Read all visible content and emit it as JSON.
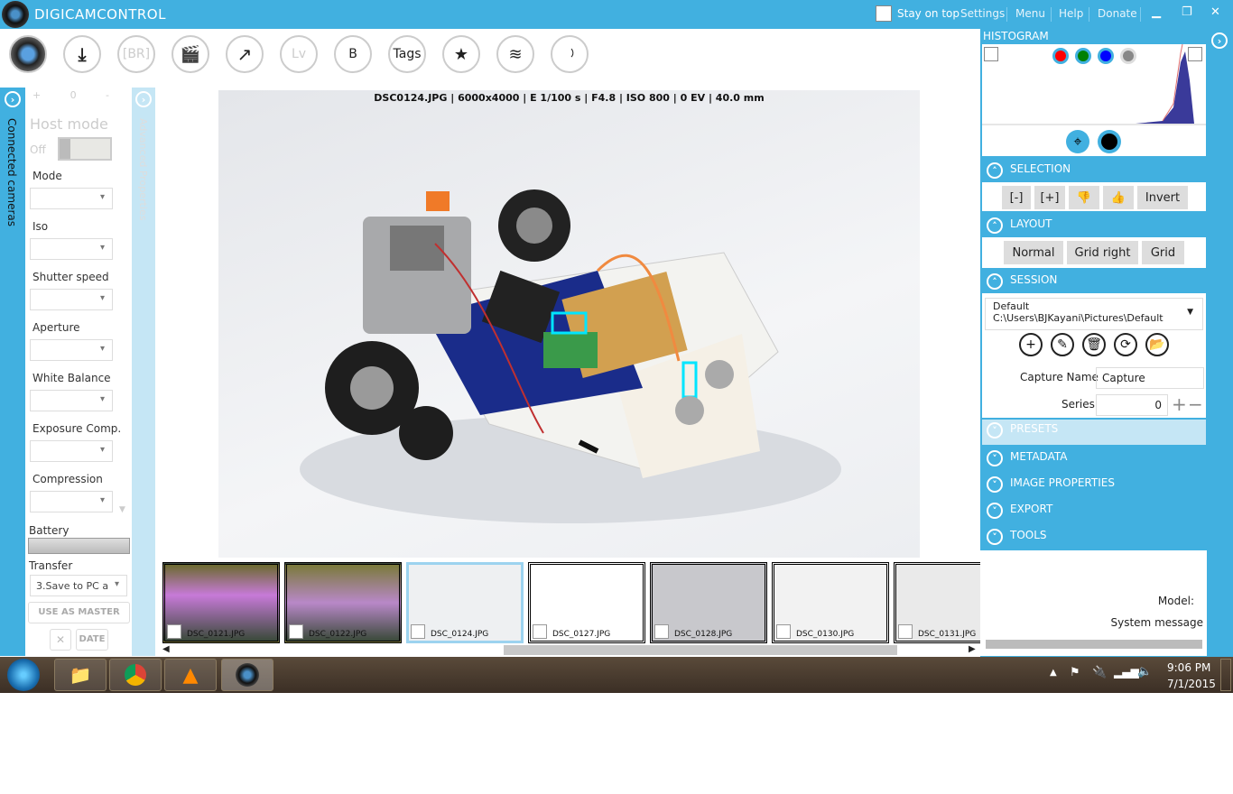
{
  "title": {
    "app": "DIGICAMCONTROL",
    "stay_on_top": "Stay on top",
    "menu": [
      "Settings",
      "Menu",
      "Help",
      "Donate"
    ]
  },
  "toolbar": [
    {
      "label": "",
      "icon": "camera-lens-icon"
    },
    {
      "label": "",
      "icon": "download-icon"
    },
    {
      "label": "[BR]"
    },
    {
      "label": "",
      "icon": "clapperboard-icon"
    },
    {
      "label": "",
      "icon": "external-link-icon"
    },
    {
      "label": "Lv"
    },
    {
      "label": "B"
    },
    {
      "label": "Tags"
    },
    {
      "label": "",
      "icon": "star-icon"
    },
    {
      "label": "",
      "icon": "layers-icon"
    },
    {
      "label": "",
      "icon": "wifi-icon"
    }
  ],
  "left": {
    "connected_cameras": "Connected cameras",
    "advanced_properties": "Advanced Properties",
    "slider": {
      "plus": "+",
      "zero": "0",
      "minus": "-"
    },
    "host_mode": "Host mode",
    "host_toggle": "Off",
    "fields": [
      "Mode",
      "Iso",
      "Shutter speed",
      "Aperture",
      "White Balance",
      "Exposure Comp.",
      "Compression"
    ],
    "battery": "Battery",
    "battery_level": null,
    "transfer": "Transfer",
    "transfer_value": "3.Save to PC a",
    "use_master": "USE AS MASTER",
    "date": "DATE"
  },
  "photo": {
    "info": "DSC0124.JPG | 6000x4000 | E 1/100 s | F4.8 | ISO 800 | 0 EV | 40.0 mm"
  },
  "thumbnails": [
    "DSC_0121.JPG",
    "DSC_0122.JPG",
    "DSC_0124.JPG",
    "DSC_0127.JPG",
    "DSC_0128.JPG",
    "DSC_0130.JPG",
    "DSC_0131.JPG"
  ],
  "right": {
    "histogram": "HISTOGRAM",
    "channel_colors": [
      "#ff0000",
      "#008000",
      "#0000ff",
      "#888888"
    ],
    "selection": "SELECTION",
    "selection_buttons": [
      "[-]",
      "[+]",
      "",
      "",
      "Invert"
    ],
    "layout": "LAYOUT",
    "layout_buttons": [
      "Normal",
      "Grid right",
      "Grid"
    ],
    "session": "SESSION",
    "session_name": "Default",
    "session_path": "C:\\Users\\BJKayani\\Pictures\\Default",
    "capture_name_label": "Capture Name",
    "capture_name": "Capture",
    "series_label": "Series",
    "series": "0",
    "presets": "PRESETS",
    "metadata": "METADATA",
    "image_properties": "IMAGE PROPERTIES",
    "export": "EXPORT",
    "tools": "TOOLS",
    "model": "Model:",
    "system_message": "System message"
  },
  "taskbar": {
    "time": "9:06 PM",
    "date": "7/1/2015"
  }
}
